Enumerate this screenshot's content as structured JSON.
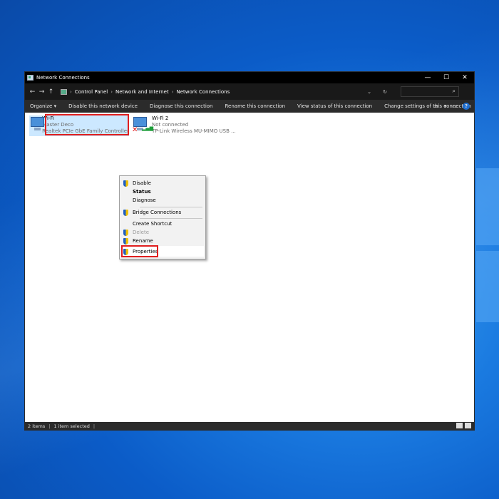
{
  "window": {
    "title": "Network Connections",
    "controls": {
      "minimize": "—",
      "maximize": "☐",
      "close": "✕"
    }
  },
  "address": {
    "breadcrumb": [
      "Control Panel",
      "Network and Internet",
      "Network Connections"
    ],
    "separator": "›",
    "back": "←",
    "forward": "→",
    "up": "↑",
    "dropdown": "⌄",
    "refresh": "↻",
    "search_placeholder": ""
  },
  "toolbar": {
    "organize": "Organize ▾",
    "disable": "Disable this network device",
    "diagnose": "Diagnose this connection",
    "rename": "Rename this connection",
    "view_status": "View status of this connection",
    "change_settings": "Change settings of this connection",
    "view_icon": "≡",
    "view_dropdown": "▾",
    "pane_icon": "▭",
    "help": "?"
  },
  "items": [
    {
      "name": "Wi-Fi",
      "network": "Master Deco",
      "adapter": "Realtek PCIe GbE Family Controller",
      "selected": true
    },
    {
      "name": "Wi-Fi 2",
      "network": "Not connected",
      "adapter": "TP-Link Wireless MU-MIMO USB ...",
      "selected": false
    }
  ],
  "context_menu": {
    "disable": "Disable",
    "status": "Status",
    "diagnose": "Diagnose",
    "bridge": "Bridge Connections",
    "shortcut": "Create Shortcut",
    "delete": "Delete",
    "rename": "Rename",
    "properties": "Properties"
  },
  "status": {
    "items_count": "2 items",
    "selected": "1 item selected",
    "divider": "|"
  },
  "colors": {
    "selection": "#cce8ff",
    "highlight_box": "#e01e1e",
    "desktop": "#0b5cc8"
  }
}
